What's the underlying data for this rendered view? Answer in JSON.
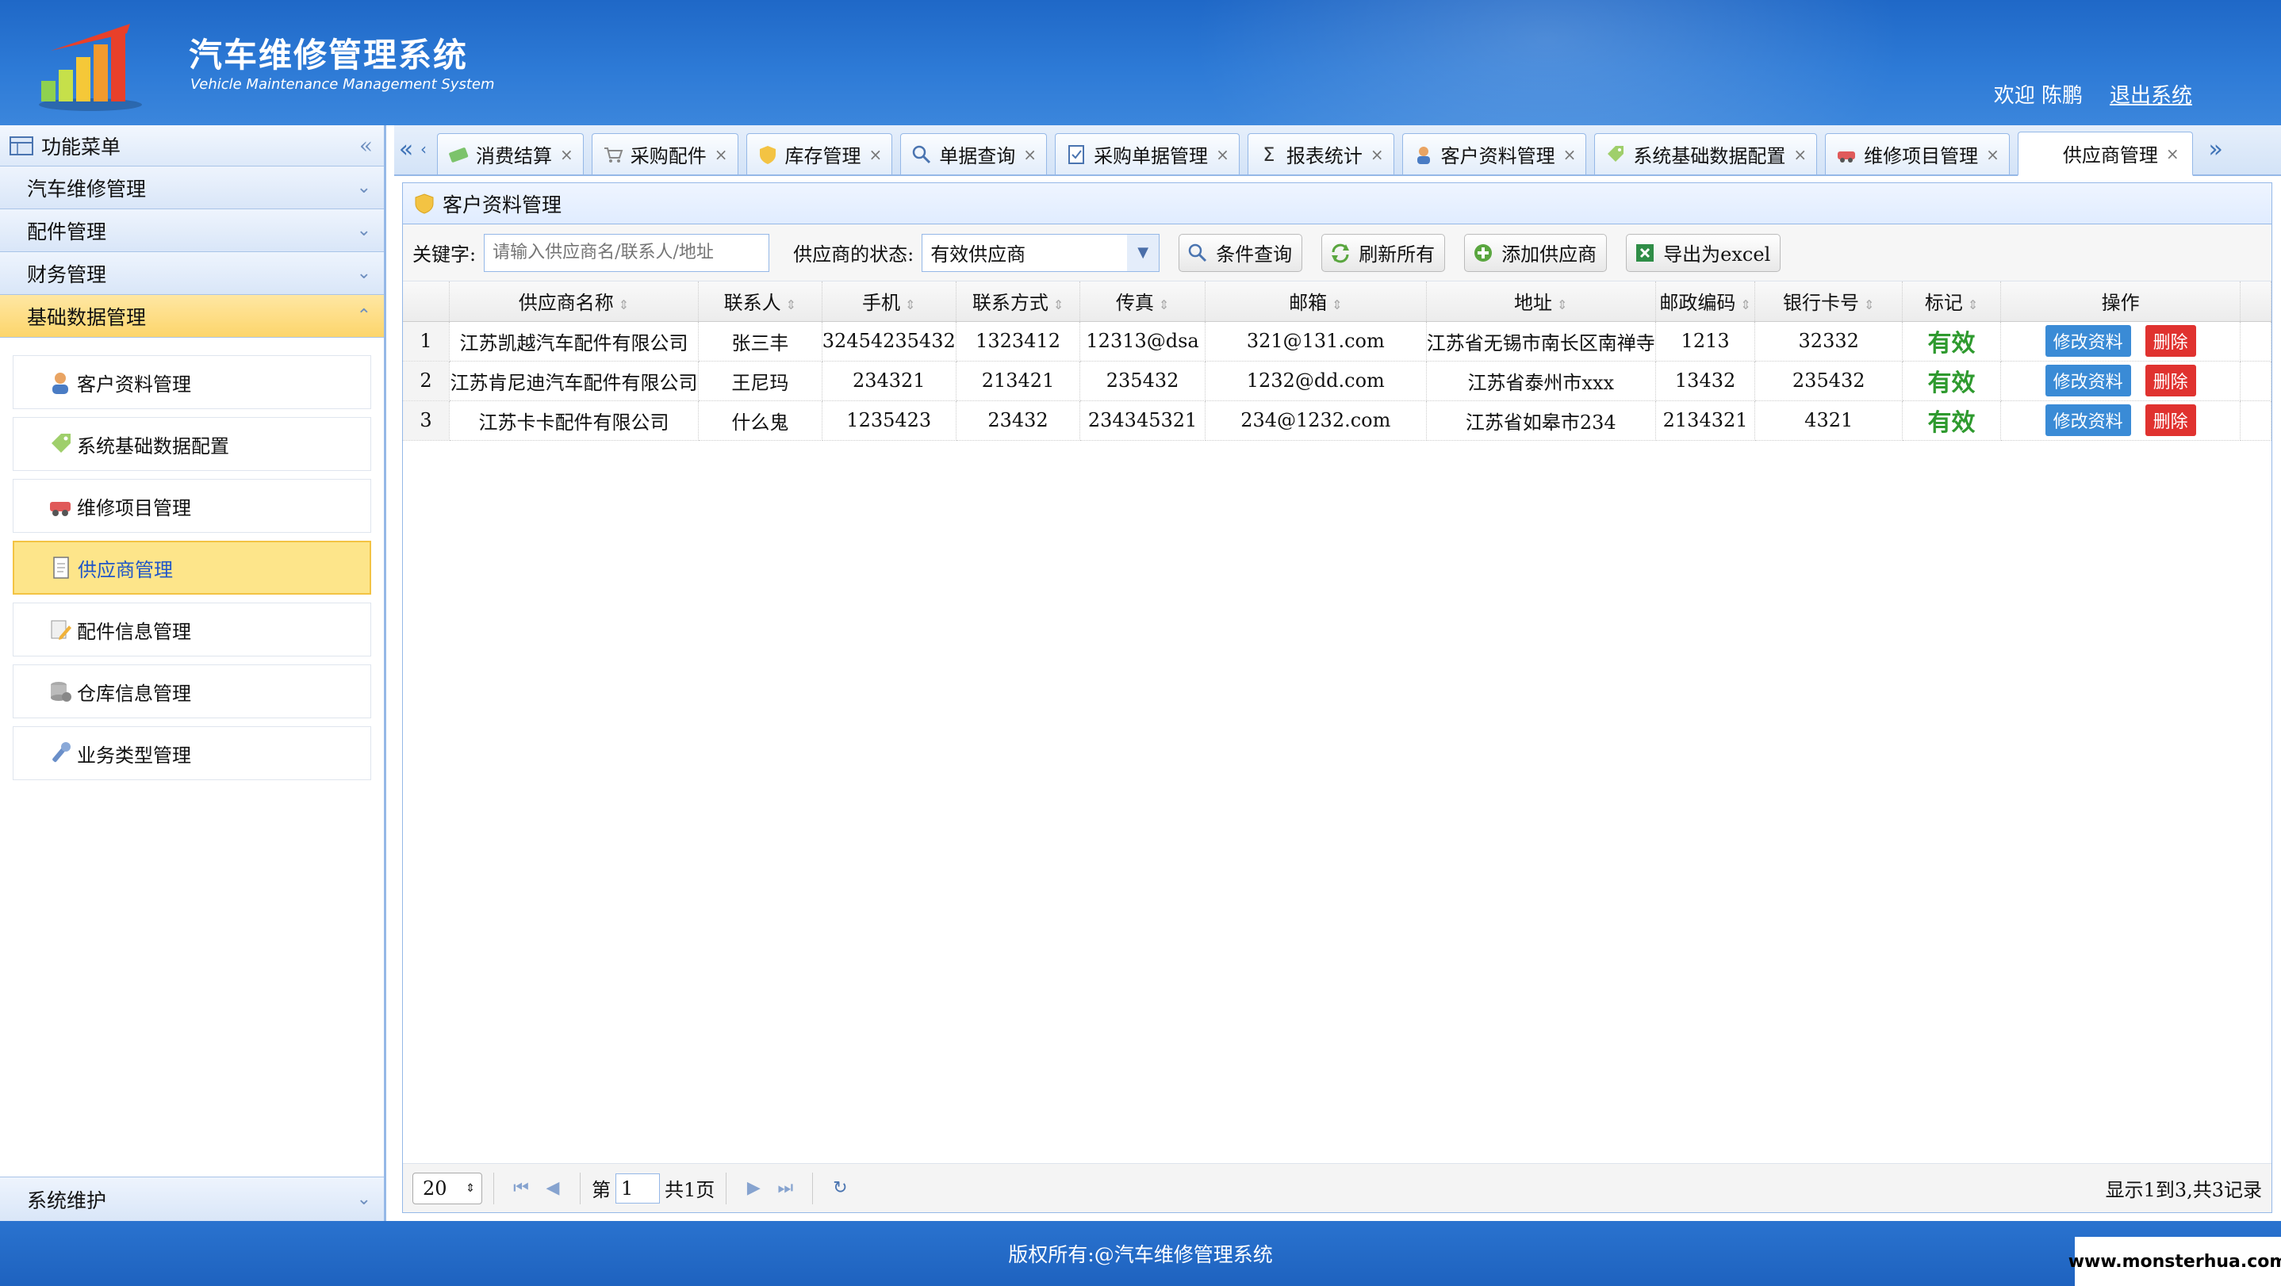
{
  "header": {
    "title": "汽车维修管理系统",
    "subtitle": "Vehicle Maintenance Management System",
    "welcome": "欢迎 陈鹏",
    "logout": "退出系统"
  },
  "sidebar": {
    "heading": "功能菜单",
    "groups": [
      {
        "label": "汽车维修管理"
      },
      {
        "label": "配件管理"
      },
      {
        "label": "财务管理"
      },
      {
        "label": "基础数据管理"
      }
    ],
    "items": [
      {
        "label": "客户资料管理",
        "icon": "user-icon"
      },
      {
        "label": "系统基础数据配置",
        "icon": "tag-icon"
      },
      {
        "label": "维修项目管理",
        "icon": "car-icon"
      },
      {
        "label": "供应商管理",
        "icon": "document-icon"
      },
      {
        "label": "配件信息管理",
        "icon": "edit-icon"
      },
      {
        "label": "仓库信息管理",
        "icon": "database-icon"
      },
      {
        "label": "业务类型管理",
        "icon": "wrench-icon"
      }
    ],
    "footer": "系统维护"
  },
  "tabs": [
    {
      "label": "消费结算",
      "icon": "money-icon"
    },
    {
      "label": "采购配件",
      "icon": "cart-icon"
    },
    {
      "label": "库存管理",
      "icon": "shield-icon"
    },
    {
      "label": "单据查询",
      "icon": "search-icon"
    },
    {
      "label": "采购单据管理",
      "icon": "checklist-icon"
    },
    {
      "label": "报表统计",
      "icon": "sigma-icon"
    },
    {
      "label": "客户资料管理",
      "icon": "user-icon"
    },
    {
      "label": "系统基础数据配置",
      "icon": "tag-icon"
    },
    {
      "label": "维修项目管理",
      "icon": "car-icon"
    },
    {
      "label": "供应商管理",
      "icon": ""
    }
  ],
  "panel": {
    "title": "客户资料管理"
  },
  "toolbar": {
    "keyword_label": "关键字:",
    "keyword_placeholder": "请输入供应商名/联系人/地址",
    "status_label": "供应商的状态:",
    "status_value": "有效供应商",
    "query_btn": "条件查询",
    "refresh_btn": "刷新所有",
    "add_btn": "添加供应商",
    "export_btn": "导出为excel"
  },
  "grid": {
    "columns": [
      "供应商名称",
      "联系人",
      "手机",
      "联系方式",
      "传真",
      "邮箱",
      "地址",
      "邮政编码",
      "银行卡号",
      "标记",
      "操作"
    ],
    "rows": [
      {
        "n": "1",
        "name": "江苏凯越汽车配件有限公司",
        "contact": "张三丰",
        "mobile": "32454235432",
        "phone": "1323412",
        "fax": "12313@dsa",
        "email": "321@131.com",
        "address": "江苏省无锡市南长区南禅寺",
        "zip": "1213",
        "bank": "32332",
        "flag": "有效"
      },
      {
        "n": "2",
        "name": "江苏肯尼迪汽车配件有限公司",
        "contact": "王尼玛",
        "mobile": "234321",
        "phone": "213421",
        "fax": "235432",
        "email": "1232@dd.com",
        "address": "江苏省泰州市xxx",
        "zip": "13432",
        "bank": "235432",
        "flag": "有效"
      },
      {
        "n": "3",
        "name": "江苏卡卡配件有限公司",
        "contact": "什么鬼",
        "mobile": "1235423",
        "phone": "23432",
        "fax": "234345321",
        "email": "234@1232.com",
        "address": "江苏省如皋市234",
        "zip": "2134321",
        "bank": "4321",
        "flag": "有效"
      }
    ],
    "edit_label": "修改资料",
    "delete_label": "删除"
  },
  "pager": {
    "page_size": "20",
    "page_prefix": "第",
    "page_value": "1",
    "page_total": "共1页",
    "info": "显示1到3,共3记录"
  },
  "footer": {
    "copyright": "版权所有:@汽车维修管理系统",
    "watermark": "www.monsterhua.com"
  },
  "colors": {
    "header_blue": "#2d7ad6",
    "active_yellow": "#fcd56b",
    "valid_green": "#2e9a2e",
    "edit_blue": "#3a8bd6",
    "delete_red": "#e0322f"
  }
}
